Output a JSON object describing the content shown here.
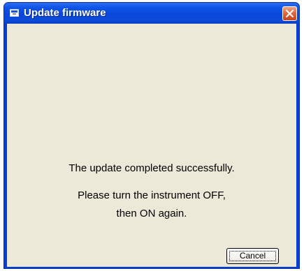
{
  "window": {
    "title": "Update firmware",
    "icon": "app-window-icon",
    "colors": {
      "titlebar": "#0a47dc",
      "client": "#ece9d8",
      "close_button": "#e2663d"
    }
  },
  "message": {
    "line1": "The update completed successfully.",
    "line2": "Please turn the instrument OFF,",
    "line3": "then ON again."
  },
  "buttons": {
    "cancel_label": "Cancel",
    "close_icon": "close-icon"
  }
}
